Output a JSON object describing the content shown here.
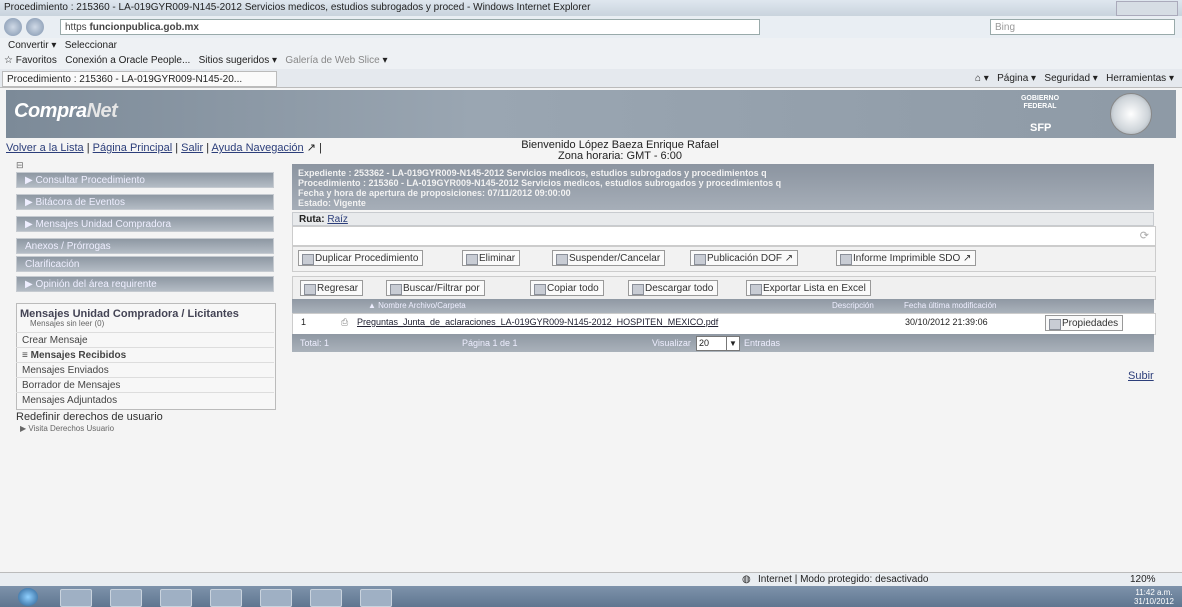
{
  "browser": {
    "window_title": "Procedimiento : 215360 - LA-019GYR009-N145-2012 Servicios medicos, estudios subrogados y proced - Windows Internet Explorer",
    "url_prefix": "https",
    "url_domain": "funcionpublica.gob.mx",
    "search_placeholder": "Bing",
    "convertir": "Convertir",
    "seleccionar": "Seleccionar",
    "favoritos": "Favoritos",
    "fav_oracle": "Conexión a Oracle People...",
    "fav_sitios": "Sitios sugeridos",
    "fav_galeria": "Galería de Web Slice",
    "tab_title": "Procedimiento : 215360 - LA-019GYR009-N145-20...",
    "cmd_pagina": "Página",
    "cmd_seguridad": "Seguridad",
    "cmd_herramientas": "Herramientas"
  },
  "banner": {
    "logo_a": "Compra",
    "logo_b": "Net",
    "gov_label": "GOBIERNO FEDERAL",
    "sfp": "SFP"
  },
  "nav": {
    "volver": "Volver a la Lista",
    "principal": "Página Principal",
    "salir": "Salir",
    "ayuda": "Ayuda Navegación"
  },
  "welcome": {
    "line1": "Bienvenido López Baeza Enrique Rafael",
    "line2": "Zona horaria: GMT - 6:00"
  },
  "sidebar": {
    "items": [
      "Consultar Procedimiento",
      "Bitácora de Eventos",
      "Mensajes Unidad Compradora",
      "Anexos / Prórrogas",
      "Clarificación",
      "Opinión del área requirente"
    ],
    "messages_title": "Mensajes Unidad Compradora / Licitantes",
    "messages_sub": "Mensajes sin leer (0)",
    "messages_items": [
      "Crear Mensaje",
      "≡ Mensajes Recibidos",
      "Mensajes Enviados",
      "Borrador de Mensajes",
      "Mensajes Adjuntados"
    ],
    "redef_title": "Redefinir derechos de usuario",
    "redef_sub": "Visita Derechos Usuario"
  },
  "expediente": {
    "line1": "Expediente : 253362 - LA-019GYR009-N145-2012 Servicios medicos, estudios subrogados y procedimientos q",
    "line2": "Procedimiento : 215360 - LA-019GYR009-N145-2012 Servicios medicos, estudios subrogados y procedimientos q",
    "line3": "Fecha y hora de apertura de proposiciones: 07/11/2012 09:00:00",
    "line4": "Estado: Vigente"
  },
  "ruta": {
    "label": "Ruta:",
    "link": "Raíz"
  },
  "actions": [
    "Duplicar Procedimiento",
    "Eliminar",
    "Suspender/Cancelar",
    "Publicación DOF",
    "Informe Imprimible SDO"
  ],
  "list_buttons": [
    "Regresar",
    "Buscar/Filtrar por",
    "Copiar todo",
    "Descargar todo",
    "Exportar Lista en Excel"
  ],
  "table": {
    "headers": [
      "Nombre Archivo/Carpeta",
      "Descripción",
      "Fecha última modificación"
    ],
    "row": {
      "num": "1",
      "name": "Preguntas_Junta_de_aclaraciones_LA-019GYR009-N145-2012_HOSPITEN_MEXICO.pdf",
      "date": "30/10/2012 21:39:06",
      "button": "Propiedades"
    },
    "footer_total": "Total: 1",
    "footer_page": "Página 1 de 1",
    "footer_visualizar": "Visualizar",
    "footer_count": "20",
    "footer_entries": "Entradas"
  },
  "subir": "Subir",
  "status": {
    "zone": "Internet | Modo protegido: desactivado",
    "zoom": "120%"
  },
  "clock": {
    "time": "11:42 a.m.",
    "date": "31/10/2012"
  }
}
